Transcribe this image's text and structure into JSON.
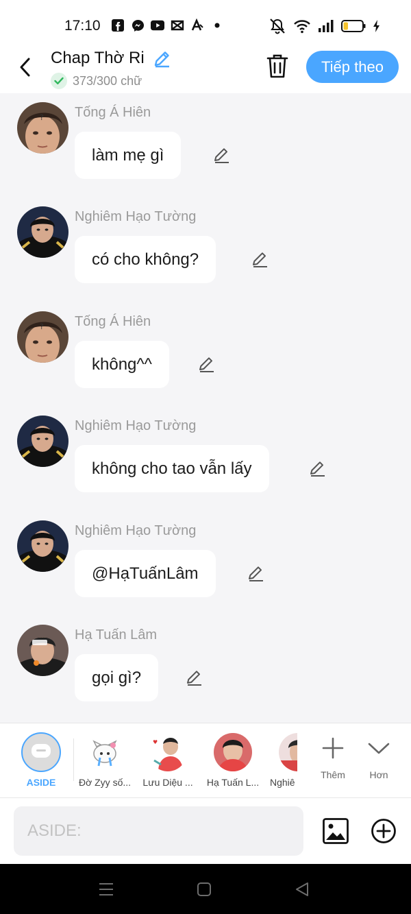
{
  "status": {
    "time": "17:10",
    "left_icons": [
      "facebook-icon",
      "messenger-icon",
      "youtube-icon",
      "capcut-icon",
      "translate-icon",
      "dot-icon"
    ],
    "right_icons": [
      "mute-icon",
      "wifi-icon",
      "signal-icon",
      "battery-icon",
      "charging-icon"
    ],
    "battery_level": 0.25
  },
  "header": {
    "title": "Chap Thờ Ri",
    "word_count": "373/300 chữ",
    "next_label": "Tiếp theo",
    "accent": "#4aa6ff"
  },
  "messages": [
    {
      "sender": "Tống Á Hiên",
      "text": "làm mẹ gì",
      "avatar": "avatar-tong-a-hien"
    },
    {
      "sender": "Nghiêm Hạo Tường",
      "text": "có cho không?",
      "avatar": "avatar-nghiem-hao-tuong"
    },
    {
      "sender": "Tống Á Hiên",
      "text": "không^^",
      "avatar": "avatar-tong-a-hien"
    },
    {
      "sender": "Nghiêm Hạo Tường",
      "text": "không cho tao vẫn lấy",
      "avatar": "avatar-nghiem-hao-tuong"
    },
    {
      "sender": "Nghiêm Hạo Tường",
      "text": "@HạTuấnLâm",
      "avatar": "avatar-nghiem-hao-tuong"
    },
    {
      "sender": "Hạ Tuấn Lâm",
      "text": "gọi gì?",
      "avatar": "avatar-ha-tuan-lam"
    }
  ],
  "characters": [
    {
      "label": "ASIDE"
    },
    {
      "label": "Đờ Zyy số..."
    },
    {
      "label": "Lưu Diệu ..."
    },
    {
      "label": "Hạ Tuấn L..."
    },
    {
      "label": "Nghiê"
    }
  ],
  "tools": {
    "add_label": "Thêm",
    "more_label": "Hơn"
  },
  "input": {
    "placeholder": "ASIDE:"
  }
}
